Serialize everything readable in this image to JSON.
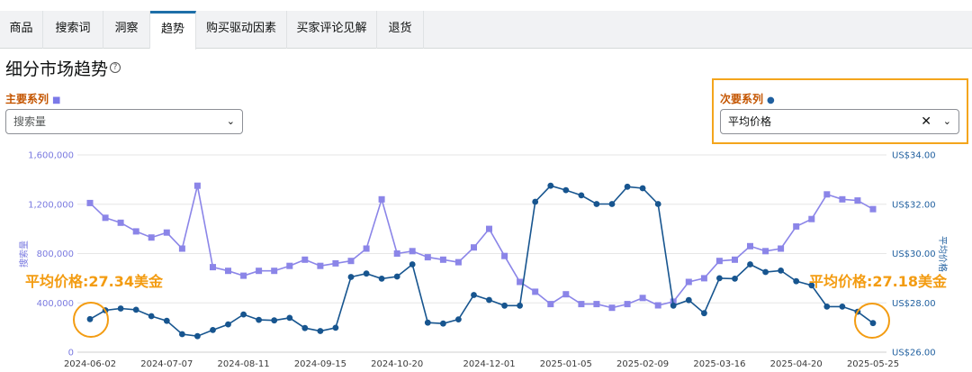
{
  "tabs": [
    {
      "label": "商品",
      "active": false
    },
    {
      "label": "搜索词",
      "active": false
    },
    {
      "label": "洞察",
      "active": false
    },
    {
      "label": "趋势",
      "active": true
    },
    {
      "label": "购买驱动因素",
      "active": false
    },
    {
      "label": "买家评论见解",
      "active": false
    },
    {
      "label": "退货",
      "active": false
    }
  ],
  "page_title": "细分市场趋势",
  "primary": {
    "label": "主要系列",
    "marker": "■",
    "select_value": "搜索量"
  },
  "secondary": {
    "label": "次要系列",
    "marker": "●",
    "select_value": "平均价格"
  },
  "annotations": {
    "left": "平均价格:27.34美金",
    "right": "平均价格:27.18美金"
  },
  "colors": {
    "primary": "#8b85e8",
    "secondary": "#17558f",
    "accent": "#f39c12",
    "tab_active": "#1e6fa8"
  },
  "chart_data": {
    "type": "line",
    "x_tick_labels": [
      "2024-06-02",
      "2024-07-07",
      "2024-08-11",
      "2024-09-15",
      "2024-10-20",
      "2024-12-01",
      "2025-01-05",
      "2025-02-09",
      "2025-03-16",
      "2025-04-20",
      "2025-05-25"
    ],
    "y_left": {
      "title": "搜索量",
      "ticks": [
        "0",
        "400,000",
        "800,000",
        "1,200,000",
        "1,600,000"
      ],
      "range": [
        0,
        1600000
      ]
    },
    "y_right": {
      "title": "平均价格",
      "ticks": [
        "US$26.00",
        "US$28.00",
        "US$30.00",
        "US$32.00",
        "US$34.00"
      ],
      "range": [
        26,
        34
      ]
    },
    "grid": true,
    "series": [
      {
        "name": "搜索量",
        "marker": "square",
        "x": [
          "2024-06-02",
          "2024-06-09",
          "2024-06-16",
          "2024-06-23",
          "2024-06-30",
          "2024-07-07",
          "2024-07-14",
          "2024-07-21",
          "2024-07-28",
          "2024-08-04",
          "2024-08-11",
          "2024-08-18",
          "2024-08-25",
          "2024-09-01",
          "2024-09-08",
          "2024-09-15",
          "2024-09-22",
          "2024-09-29",
          "2024-10-06",
          "2024-10-13",
          "2024-10-20",
          "2024-10-27",
          "2024-11-03",
          "2024-11-10",
          "2024-11-17",
          "2024-11-24",
          "2024-12-01",
          "2024-12-08",
          "2024-12-15",
          "2024-12-22",
          "2024-12-29",
          "2025-01-05",
          "2025-01-12",
          "2025-01-19",
          "2025-01-26",
          "2025-02-02",
          "2025-02-09",
          "2025-02-16",
          "2025-02-23",
          "2025-03-02",
          "2025-03-09",
          "2025-03-16",
          "2025-03-23",
          "2025-03-30",
          "2025-04-06",
          "2025-04-13",
          "2025-04-20",
          "2025-04-27",
          "2025-05-04",
          "2025-05-11",
          "2025-05-18",
          "2025-05-25"
        ],
        "values": [
          1210000,
          1090000,
          1050000,
          980000,
          930000,
          970000,
          840000,
          1350000,
          690000,
          660000,
          620000,
          660000,
          660000,
          700000,
          750000,
          700000,
          720000,
          740000,
          840000,
          1240000,
          800000,
          820000,
          770000,
          750000,
          730000,
          850000,
          1000000,
          780000,
          570000,
          490000,
          390000,
          470000,
          390000,
          390000,
          360000,
          390000,
          440000,
          380000,
          410000,
          570000,
          600000,
          740000,
          750000,
          860000,
          820000,
          840000,
          1020000,
          1080000,
          1280000,
          1240000,
          1230000,
          1160000
        ]
      },
      {
        "name": "平均价格",
        "marker": "circle",
        "x": [
          "2024-06-02",
          "2024-06-09",
          "2024-06-16",
          "2024-06-23",
          "2024-06-30",
          "2024-07-07",
          "2024-07-14",
          "2024-07-21",
          "2024-07-28",
          "2024-08-04",
          "2024-08-11",
          "2024-08-18",
          "2024-08-25",
          "2024-09-01",
          "2024-09-08",
          "2024-09-15",
          "2024-09-22",
          "2024-09-29",
          "2024-10-06",
          "2024-10-13",
          "2024-10-20",
          "2024-10-27",
          "2024-11-03",
          "2024-11-10",
          "2024-11-17",
          "2024-11-24",
          "2024-12-01",
          "2024-12-08",
          "2024-12-15",
          "2024-12-22",
          "2024-12-29",
          "2025-01-05",
          "2025-01-12",
          "2025-01-19",
          "2025-01-26",
          "2025-02-02",
          "2025-02-09",
          "2025-02-16",
          "2025-02-23",
          "2025-03-02",
          "2025-03-09",
          "2025-03-16",
          "2025-03-23",
          "2025-03-30",
          "2025-04-06",
          "2025-04-13",
          "2025-04-20",
          "2025-04-27",
          "2025-05-04",
          "2025-05-11",
          "2025-05-18",
          "2025-05-25"
        ],
        "values": [
          27.34,
          27.7,
          27.77,
          27.72,
          27.46,
          27.27,
          26.73,
          26.65,
          26.9,
          27.13,
          27.53,
          27.31,
          27.29,
          27.39,
          26.98,
          26.86,
          26.99,
          29.05,
          29.19,
          28.98,
          29.07,
          29.56,
          27.2,
          27.16,
          27.33,
          28.32,
          28.12,
          27.89,
          27.89,
          32.1,
          32.75,
          32.57,
          32.36,
          32.01,
          32.01,
          32.71,
          32.65,
          32.01,
          27.89,
          28.11,
          27.58,
          29.0,
          28.98,
          29.56,
          29.25,
          29.31,
          28.88,
          28.71,
          27.85,
          27.85,
          27.64,
          27.18
        ]
      }
    ]
  }
}
